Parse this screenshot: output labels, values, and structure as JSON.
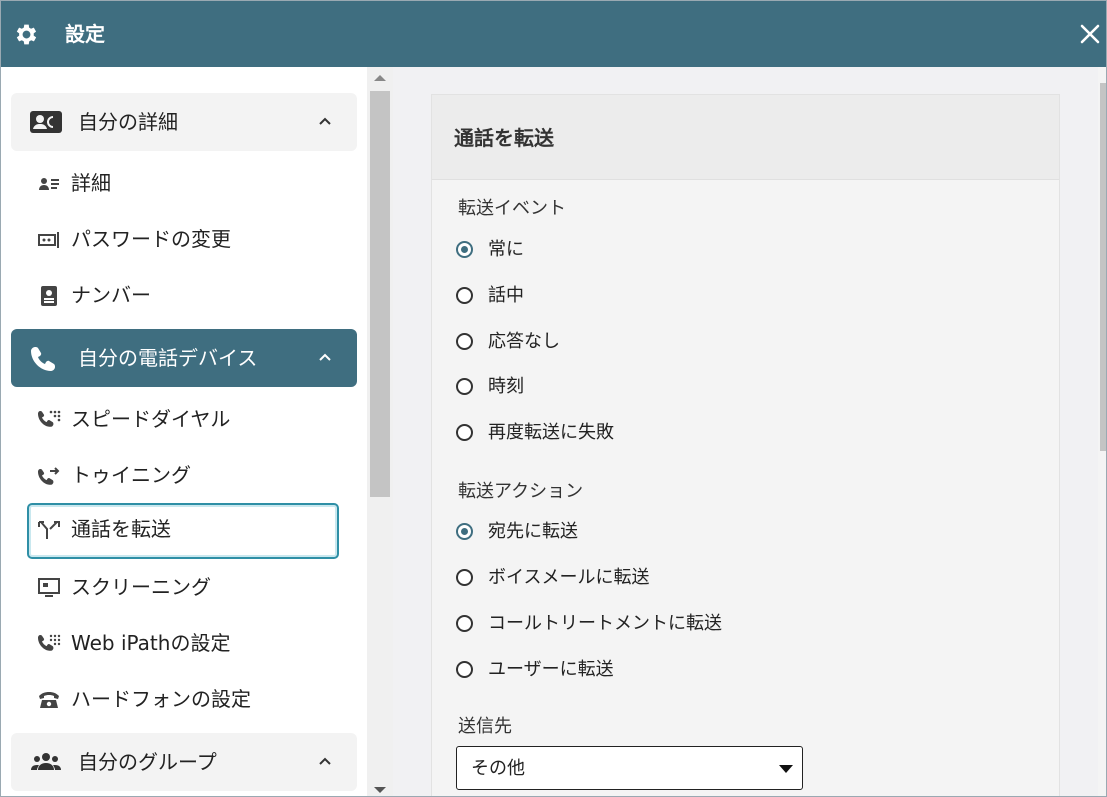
{
  "window": {
    "title": "設定",
    "settings_icon": "gear-icon",
    "close_icon": "close-icon"
  },
  "sidebar": {
    "groups": [
      {
        "label": "自分の詳細",
        "icon": "contact-card-icon",
        "expanded": true,
        "items": [
          {
            "label": "詳細",
            "icon": "user-details-icon"
          },
          {
            "label": "パスワードの変更",
            "icon": "password-icon"
          },
          {
            "label": "ナンバー",
            "icon": "badge-icon"
          }
        ]
      },
      {
        "label": "自分の電話デバイス",
        "icon": "phone-icon",
        "expanded": true,
        "active": true,
        "items": [
          {
            "label": "スピードダイヤル",
            "icon": "speed-dial-icon"
          },
          {
            "label": "トゥイニング",
            "icon": "phone-forward-icon"
          },
          {
            "label": "通話を転送",
            "icon": "call-split-icon",
            "selected": true
          },
          {
            "label": "スクリーニング",
            "icon": "screen-icon"
          },
          {
            "label": "Web iPathの設定",
            "icon": "dialpad-phone-icon"
          },
          {
            "label": "ハードフォンの設定",
            "icon": "desk-phone-icon"
          }
        ]
      },
      {
        "label": "自分のグループ",
        "icon": "group-icon",
        "expanded": true,
        "items": []
      }
    ]
  },
  "panel": {
    "title": "通話を転送",
    "event_section": {
      "label": "転送イベント",
      "options": [
        "常に",
        "話中",
        "応答なし",
        "時刻",
        "再度転送に失敗"
      ],
      "selected": "常に"
    },
    "action_section": {
      "label": "転送アクション",
      "options": [
        "宛先に転送",
        "ボイスメールに転送",
        "コールトリートメントに転送",
        "ユーザーに転送"
      ],
      "selected": "宛先に転送"
    },
    "destination": {
      "label": "送信先",
      "value": "その他"
    }
  },
  "colors": {
    "accent": "#3f6e80",
    "focus_ring": "#2f8fa6"
  }
}
